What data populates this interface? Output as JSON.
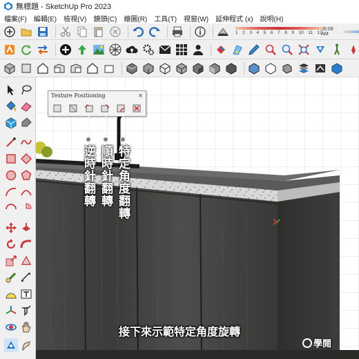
{
  "window": {
    "title": "無標題 - SketchUp Pro 2023"
  },
  "menu": [
    {
      "name": "menu-file",
      "label": "檔案(F)"
    },
    {
      "name": "menu-edit",
      "label": "編輯(E)"
    },
    {
      "name": "menu-view",
      "label": "檢視(V)"
    },
    {
      "name": "menu-camera",
      "label": "鏡頭(C)"
    },
    {
      "name": "menu-draw",
      "label": "繪圖(R)"
    },
    {
      "name": "menu-tools",
      "label": "工具(T)"
    },
    {
      "name": "menu-window",
      "label": "視窗(W)"
    },
    {
      "name": "menu-extensions",
      "label": "延伸程式 (x)"
    },
    {
      "name": "menu-help",
      "label": "說明(H)"
    }
  ],
  "shadow_settings": {
    "months": [
      "1",
      "2",
      "3",
      "4",
      "5",
      "6",
      "7",
      "8",
      "9",
      "10",
      "11",
      "12"
    ],
    "time": "06:09 AM"
  },
  "texture_positioning": {
    "title": "Texture Positioning",
    "close": "×",
    "buttons": [
      "reset-icon",
      "fit-icon",
      "rotate-ccw-icon",
      "rotate-cw-icon",
      "rotate-angle-icon",
      "flip-icon"
    ]
  },
  "annotations": {
    "ccw": "逆時針翻轉",
    "cw": "順時針翻轉",
    "angle": "特定角度翻轉"
  },
  "subtitle": "接下來示範特定角度旋轉",
  "watermark": "學閱"
}
